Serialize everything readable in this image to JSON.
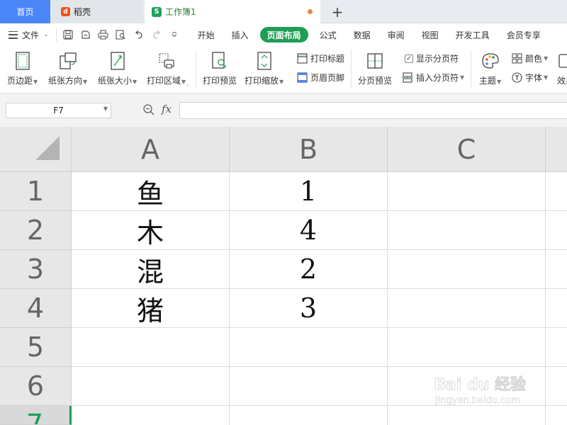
{
  "tabs": {
    "home": "首页",
    "daoke": "稻壳",
    "workbook": "工作簿1",
    "add": "+"
  },
  "menu": {
    "file": "文件",
    "items": [
      "开始",
      "插入",
      "页面布局",
      "公式",
      "数据",
      "审阅",
      "视图",
      "开发工具",
      "会员专享"
    ],
    "active": "页面布局"
  },
  "ribbon": {
    "margins": "页边距",
    "orientation": "纸张方向",
    "size": "纸张大小",
    "print_area": "打印区域",
    "print_preview": "打印预览",
    "print_scale": "打印缩放",
    "print_titles": "打印标题",
    "header_footer": "页眉页脚",
    "page_break_preview": "分页预览",
    "show_page_breaks": "显示分页符",
    "insert_page_break": "插入分页符",
    "theme": "主题",
    "colors": "颜色",
    "fonts": "字体",
    "effects": "效果"
  },
  "formula_bar": {
    "name_box": "F7",
    "fx": "fx",
    "value": ""
  },
  "sheet": {
    "columns": [
      "A",
      "B",
      "C"
    ],
    "rows": [
      "1",
      "2",
      "3",
      "4",
      "5",
      "6",
      "7"
    ],
    "selected_row": "7",
    "cells": {
      "A1": "鱼",
      "B1": "1",
      "A2": "木",
      "B2": "4",
      "A3": "混",
      "B3": "2",
      "A4": "猪",
      "B4": "3"
    }
  },
  "watermark": {
    "main": "Bai du 经验",
    "sub": "jingyan.baidu.com"
  },
  "colors": {
    "accent_green": "#1f9e56",
    "tab_blue": "#4a86f7",
    "daoke_orange": "#e9531d"
  }
}
